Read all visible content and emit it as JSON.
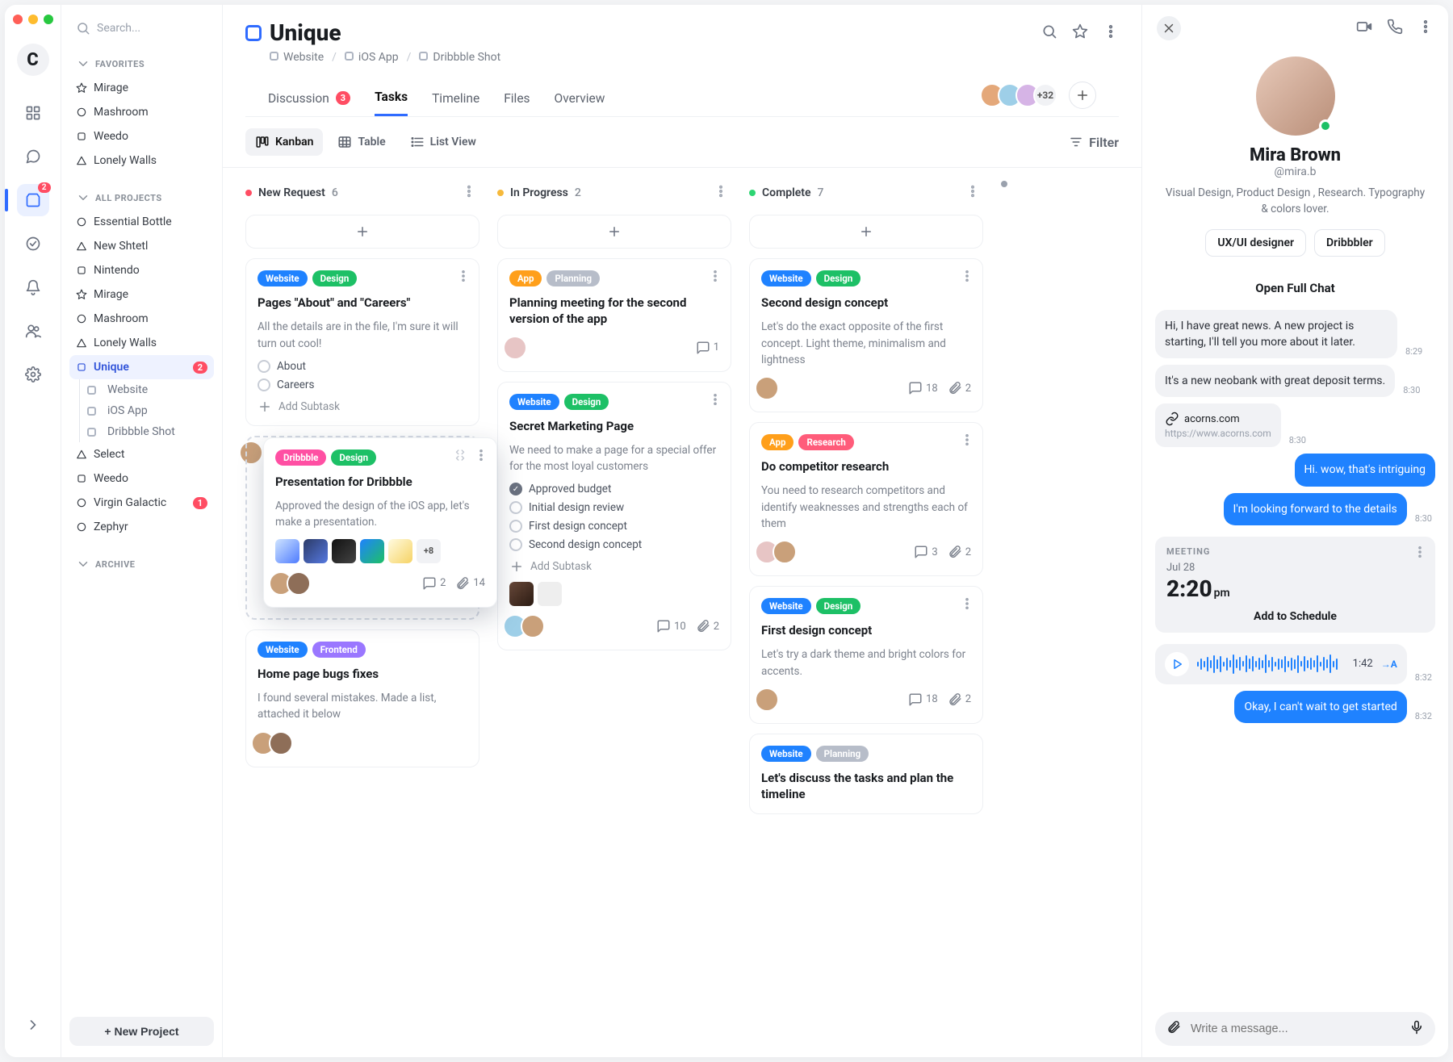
{
  "search_placeholder": "Search...",
  "rail": {
    "logo": "C",
    "folder_badge": "2"
  },
  "sidebar": {
    "favorites_label": "FAVORITES",
    "all_projects_label": "ALL PROJECTS",
    "archive_label": "ARCHIVE",
    "favorites": [
      {
        "name": "Mirage",
        "color": "#f6b93b",
        "shape": "star"
      },
      {
        "name": "Mashroom",
        "color": "#7b6ef6",
        "shape": "circle"
      },
      {
        "name": "Weedo",
        "color": "#ff5fb3",
        "shape": "square"
      },
      {
        "name": "Lonely Walls",
        "color": "#2ed573",
        "shape": "triangle"
      }
    ],
    "projects": [
      {
        "name": "Essential Bottle",
        "color": "#c8cdd6",
        "shape": "circle"
      },
      {
        "name": "New Shtetl",
        "color": "#c8cdd6",
        "shape": "triangle"
      },
      {
        "name": "Nintendo",
        "color": "#c8cdd6",
        "shape": "square"
      },
      {
        "name": "Mirage",
        "color": "#f6b93b",
        "shape": "star"
      },
      {
        "name": "Mashroom",
        "color": "#7b6ef6",
        "shape": "circle"
      },
      {
        "name": "Lonely Walls",
        "color": "#2ed573",
        "shape": "triangle"
      },
      {
        "name": "Unique",
        "color": "#2f6bff",
        "shape": "square",
        "selected": true,
        "badge": "2",
        "children": [
          "Website",
          "iOS App",
          "Dribbble Shot"
        ]
      },
      {
        "name": "Select",
        "color": "#c8cdd6",
        "shape": "triangle"
      },
      {
        "name": "Weedo",
        "color": "#ff5fb3",
        "shape": "square"
      },
      {
        "name": "Virgin Galactic",
        "color": "#c8cdd6",
        "shape": "circle",
        "badge": "1"
      },
      {
        "name": "Zephyr",
        "color": "#7b6ef6",
        "shape": "circle"
      }
    ],
    "new_project": "+ New Project"
  },
  "header": {
    "title": "Unique",
    "crumbs": [
      "Website",
      "iOS App",
      "Dribbble Shot"
    ],
    "tabs": [
      {
        "label": "Discussion",
        "count": "3"
      },
      {
        "label": "Tasks",
        "active": true
      },
      {
        "label": "Timeline"
      },
      {
        "label": "Files"
      },
      {
        "label": "Overview"
      }
    ],
    "avatar_more": "+32"
  },
  "views": {
    "kanban": "Kanban",
    "table": "Table",
    "list": "List View",
    "filter": "Filter"
  },
  "columns": [
    {
      "name": "New Request",
      "count": "6",
      "color": "#ff4d63"
    },
    {
      "name": "In Progress",
      "count": "2",
      "color": "#f6b93b"
    },
    {
      "name": "Complete",
      "count": "7",
      "color": "#2ed573"
    }
  ],
  "tag_colors": {
    "Website": "#1f82ff",
    "Design": "#1dc066",
    "App": "#ff9f1a",
    "Planning": "#b7bdc9",
    "Dribbble": "#ff4fa3",
    "Frontend": "#9a77ff",
    "Research": "#ff5c7a"
  },
  "cards": {
    "c1": {
      "tags": [
        "Website",
        "Design"
      ],
      "title": "Pages \"About\" and  \"Careers\"",
      "desc": "All the details are in the file, I'm sure it will turn out cool!",
      "subs": [
        "About",
        "Careers"
      ],
      "add_sub": "Add Subtask"
    },
    "c1b": {
      "tags": [
        "Dribbble",
        "Design"
      ],
      "title": "Presentation for Dribbble",
      "desc": "Approved the design of the iOS app, let's make a presentation.",
      "thumbs_more": "+8",
      "comments": "2",
      "attach": "14"
    },
    "c1c": {
      "tags": [
        "Website",
        "Frontend"
      ],
      "title": "Home page bugs fixes",
      "desc": "I found several mistakes. Made a list, attached it below"
    },
    "c2": {
      "tags": [
        "App",
        "Planning"
      ],
      "title": "Planning meeting for the second version of the app",
      "comments": "1"
    },
    "c2b": {
      "tags": [
        "Website",
        "Design"
      ],
      "title": "Secret Marketing Page",
      "desc": "We need to make a page for a special offer for the most loyal customers",
      "subs": [
        {
          "t": "Approved budget",
          "done": true
        },
        {
          "t": "Initial design review"
        },
        {
          "t": "First design concept"
        },
        {
          "t": "Second design concept"
        }
      ],
      "add_sub": "Add Subtask",
      "comments": "10",
      "attach": "2"
    },
    "c3": {
      "tags": [
        "Website",
        "Design"
      ],
      "title": "Second design concept",
      "desc": "Let's do the exact opposite of the first concept. Light theme, minimalism and lightness",
      "comments": "18",
      "attach": "2"
    },
    "c3b": {
      "tags": [
        "App",
        "Research"
      ],
      "title": "Do competitor research",
      "desc": "You need to research competitors and identify weaknesses and strengths each of them",
      "comments": "3",
      "attach": "2"
    },
    "c3c": {
      "tags": [
        "Website",
        "Design"
      ],
      "title": "First design concept",
      "desc": "Let's try a dark theme and bright colors for accents.",
      "comments": "18",
      "attach": "2"
    },
    "c3d": {
      "tags": [
        "Website",
        "Planning"
      ],
      "title": "Let's discuss the tasks and plan the timeline"
    }
  },
  "chat": {
    "name": "Mira Brown",
    "handle": "@mira.b",
    "bio": "Visual Design, Product Design , Research. Typography & colors lover.",
    "chips": [
      "UX/UI designer",
      "Dribbbler"
    ],
    "open_full": "Open Full Chat",
    "messages": {
      "m1": {
        "text": "Hi, I have great news. A new project is starting, I'll tell you more about it later.",
        "ts": "8:29"
      },
      "m2": {
        "text": "It's a new neobank with great deposit terms.",
        "ts": "8:30"
      },
      "m3_link": {
        "title": "acorns.com",
        "url": "https://www.acorns.com",
        "ts": "8:30"
      },
      "m4": {
        "text": "Hi. wow, that's intriguing"
      },
      "m5": {
        "text": "I'm looking forward to the details",
        "ts": "8:30"
      },
      "meeting": {
        "label": "MEETING",
        "date": "Jul 28",
        "time": "2:20",
        "ampm": "pm",
        "sched": "Add to Schedule"
      },
      "voice": {
        "dur": "1:42",
        "toa": "→A",
        "ts": "8:32"
      },
      "m6": {
        "text": "Okay, I can't wait to get started",
        "ts": "8:32"
      }
    },
    "compose_placeholder": "Write a message..."
  }
}
